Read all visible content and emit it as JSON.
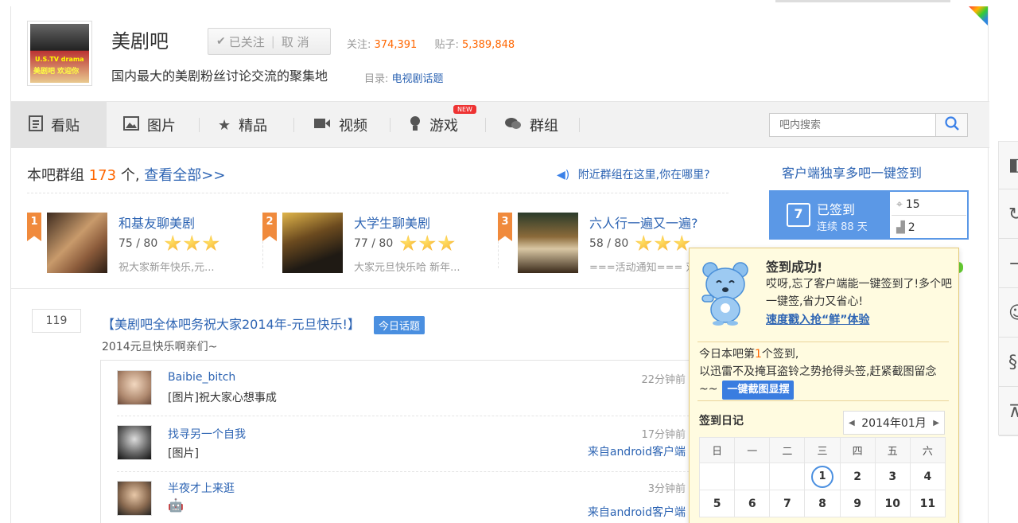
{
  "forum": {
    "name": "美剧吧",
    "follow_label": "已关注",
    "cancel_label": "取 消",
    "followers_label": "关注:",
    "followers": "374,391",
    "posts_label": "贴子:",
    "posts": "5,389,848",
    "description": "国内最大的美剧粉丝讨论交流的聚集地",
    "catalog_label": "目录:",
    "catalog_link": "电视剧话题",
    "logo_text1": "U.S.TV drama",
    "logo_text2": "美剧吧 欢迎你"
  },
  "nav": {
    "tabs": [
      {
        "label": "看贴",
        "icon": "document-icon"
      },
      {
        "label": "图片",
        "icon": "image-icon"
      },
      {
        "label": "精品",
        "icon": "star-icon"
      },
      {
        "label": "视频",
        "icon": "video-icon"
      },
      {
        "label": "游戏",
        "icon": "game-icon"
      },
      {
        "label": "群组",
        "icon": "chat-icon"
      }
    ],
    "new_badge": "NEW",
    "search_placeholder": "吧内搜索"
  },
  "groups": {
    "title_prefix": "本吧群组",
    "count": "173",
    "title_suffix": "个,",
    "view_all": "查看全部>>",
    "nearby": "附近群组在这里,你在哪里?",
    "items": [
      {
        "rank": "1",
        "name": "和基友聊美剧",
        "count": "75 / 80",
        "note": "祝大家新年快乐,元..."
      },
      {
        "rank": "2",
        "name": "大学生聊美剧",
        "count": "77 / 80",
        "note": "大家元旦快乐哈 新年..."
      },
      {
        "rank": "3",
        "name": "六人行一遍又一遍?",
        "count": "58 / 80",
        "note": "===活动通知=== 双"
      }
    ]
  },
  "post": {
    "reply_count": "119",
    "title": "【美剧吧全体吧务祝大家2014年-元旦快乐!】",
    "tag": "今日话题",
    "subtitle": "2014元旦快乐啊亲们~",
    "replies": [
      {
        "user": "Baibie_bitch",
        "text": "[图片]祝大家心想事成",
        "time": "22分钟前",
        "source": ""
      },
      {
        "user": "找寻另一个自我",
        "text": "[图片]",
        "time": "17分钟前",
        "source": "来自android客户端"
      },
      {
        "user": "半夜才上来逛",
        "text": "",
        "time": "3分钟前",
        "source": "来自android客户端"
      }
    ]
  },
  "signin": {
    "title": "客户端独享多吧一键签到",
    "status": "已签到",
    "streak": "连续 88 天",
    "calendar_day": "7",
    "rank_value": "15",
    "level_value": "2"
  },
  "popup": {
    "title": "签到成功!",
    "message": "哎呀,忘了客户端能一键签到了!多个吧一键签,省力又省心!",
    "link": "速度戳入抢“鲜”体验",
    "rank_prefix": "今日本吧第",
    "rank_num": "1",
    "rank_suffix": "个签到,",
    "rank_line2": "以迅雷不及掩耳盗铃之势抢得头签,赶紧截图留念~~",
    "screenshot_btn": "一键截图显摆",
    "diary": "签到日记",
    "month": "2014年01月",
    "weekdays": [
      "日",
      "一",
      "二",
      "三",
      "四",
      "五",
      "六"
    ],
    "week1": [
      "",
      "",
      "",
      "1",
      "2",
      "3",
      "4"
    ],
    "week2": [
      "5",
      "6",
      "7",
      "8",
      "9",
      "10",
      "11"
    ]
  },
  "colors": {
    "link": "#2d64b3",
    "accent_orange": "#f60",
    "signin_blue": "#5b98e6",
    "popup_bg": "#fffbe0"
  }
}
